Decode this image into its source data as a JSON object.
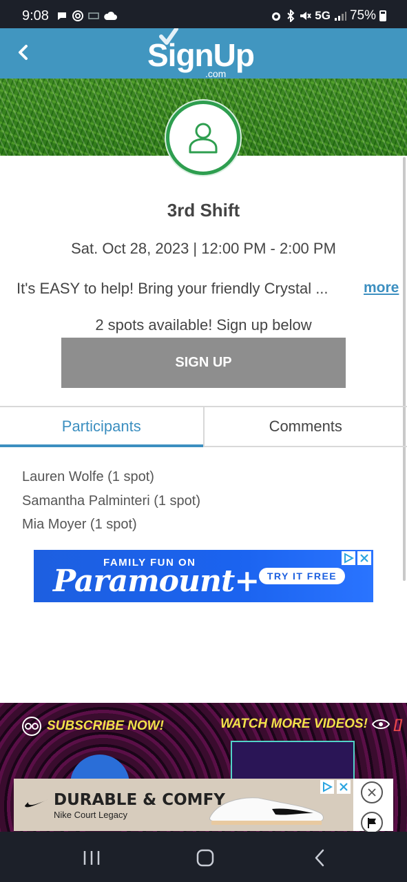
{
  "status_bar": {
    "time": "9:08",
    "network": "5G",
    "battery": "75%"
  },
  "header": {
    "logo_text": "SignUp",
    "logo_suffix": ".com",
    "back_icon": "chevron-left-icon"
  },
  "slot": {
    "title": "3rd Shift",
    "datetime": "Sat. Oct 28, 2023 | 12:00 PM - 2:00 PM",
    "description": "It's EASY to help! Bring your friendly Crystal ...",
    "more_label": "more",
    "spots_text": "2 spots available! Sign up below",
    "signup_label": "SIGN UP"
  },
  "tabs": [
    {
      "label": "Participants",
      "active": true
    },
    {
      "label": "Comments",
      "active": false
    }
  ],
  "participants": [
    "Lauren Wolfe (1 spot)",
    "Samantha Palminteri (1 spot)",
    "Mia Moyer (1 spot)"
  ],
  "ads": {
    "paramount": {
      "tagline": "FAMILY FUN ON",
      "brand": "Paramount+",
      "cta": "TRY IT FREE"
    },
    "video": {
      "subscribe": "SUBSCRIBE NOW!",
      "watch": "WATCH MORE VIDEOS!"
    },
    "nike": {
      "headline": "DURABLE & COMFY",
      "subline": "Nike Court Legacy"
    }
  },
  "colors": {
    "header": "#4196c0",
    "accent": "#3c8fc0",
    "avatar_ring": "#2e9e4f",
    "button": "#8e8e8e",
    "status_bar": "#1c2029"
  }
}
